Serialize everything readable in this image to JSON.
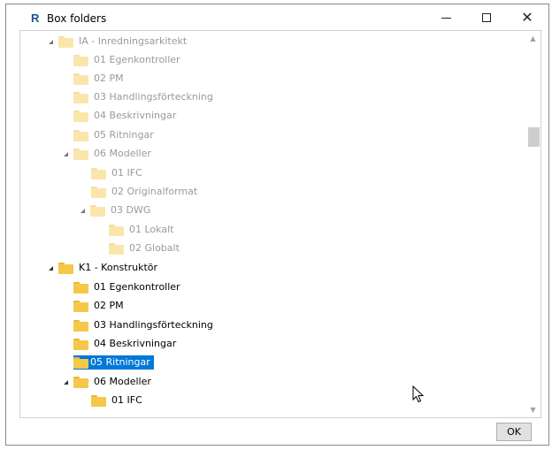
{
  "window": {
    "title": "Box folders",
    "app_icon_letter": "R",
    "minimize_glyph": "",
    "maximize_glyph": "",
    "close_glyph": "✕"
  },
  "tree": {
    "items": [
      {
        "label": "IA - Inredningsarkitekt",
        "expanded": true,
        "dim": true
      },
      {
        "label": "01 Egenkontroller",
        "dim": true
      },
      {
        "label": "02 PM",
        "dim": true
      },
      {
        "label": "03 Handlingsförteckning",
        "dim": true
      },
      {
        "label": "04 Beskrivningar",
        "dim": true
      },
      {
        "label": "05 Ritningar",
        "dim": true
      },
      {
        "label": "06 Modeller",
        "expanded": true,
        "dim": true
      },
      {
        "label": "01 IFC",
        "dim": true
      },
      {
        "label": "02 Originalformat",
        "dim": true
      },
      {
        "label": "03 DWG",
        "expanded": true,
        "dim": true
      },
      {
        "label": "01 Lokalt",
        "dim": true
      },
      {
        "label": "02 Globalt",
        "dim": true
      },
      {
        "label": "K1 - Konstruktör",
        "expanded": true
      },
      {
        "label": "01 Egenkontroller"
      },
      {
        "label": "02 PM"
      },
      {
        "label": "03 Handlingsförteckning"
      },
      {
        "label": "04 Beskrivningar"
      },
      {
        "label": "05 Ritningar",
        "selected": true
      },
      {
        "label": "06 Modeller",
        "expanded": true
      },
      {
        "label": "01 IFC"
      }
    ]
  },
  "buttons": {
    "ok_label": "OK"
  },
  "colors": {
    "selection": "#0078d7",
    "folder": "#f5c84a"
  }
}
